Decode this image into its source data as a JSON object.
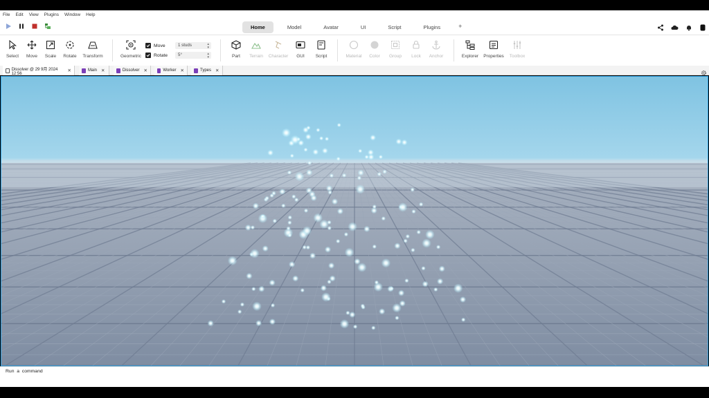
{
  "menubar": [
    "File",
    "Edit",
    "View",
    "Plugins",
    "Window",
    "Help"
  ],
  "tabs": [
    {
      "label": "Home",
      "active": true
    },
    {
      "label": "Model"
    },
    {
      "label": "Avatar"
    },
    {
      "label": "UI"
    },
    {
      "label": "Script"
    },
    {
      "label": "Plugins"
    }
  ],
  "tab_add": "+",
  "ribbon": {
    "tools": {
      "select": "Select",
      "move": "Move",
      "scale": "Scale",
      "rotate": "Rotate",
      "transform": "Transform"
    },
    "geometric": "Geometric",
    "move_check_label": "Move",
    "rotate_check_label": "Rotate",
    "move_value": "1 studs",
    "rotate_value": "5°",
    "insert": {
      "part": "Part",
      "terrain": "Terrain",
      "character": "Character",
      "gui": "GUI",
      "script": "Script"
    },
    "edit": {
      "material": "Material",
      "color": "Color",
      "group": "Group",
      "lock": "Lock",
      "anchor": "Anchor"
    },
    "panels": {
      "explorer": "Explorer",
      "properties": "Properties",
      "toolbox": "Toolbox"
    }
  },
  "doc_tabs": [
    {
      "label": "Dissolver @ 29 9月 2024 12:56",
      "kind": "place",
      "active": true
    },
    {
      "label": "Main",
      "kind": "script"
    },
    {
      "label": "Dissolver",
      "kind": "script"
    },
    {
      "label": "Worker",
      "kind": "script"
    },
    {
      "label": "Types",
      "kind": "script"
    }
  ],
  "close_glyph": "✕",
  "command": {
    "placeholder": "Run  a  command"
  },
  "colors": {
    "accent": "#2fa0e0",
    "stop": "#c0302c",
    "script_icon": "#7b3fb8",
    "sky_top": "#7fc3e2",
    "floor": "#8f9cb0"
  }
}
